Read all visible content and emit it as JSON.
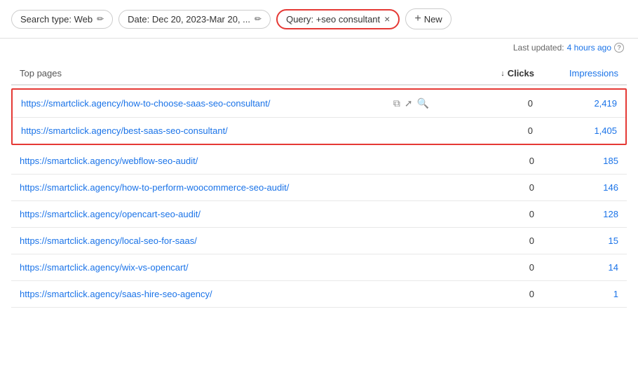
{
  "filterBar": {
    "searchType": {
      "label": "Search type: Web",
      "editIcon": "✏"
    },
    "date": {
      "label": "Date: Dec 20, 2023-Mar 20, ...",
      "editIcon": "✏"
    },
    "query": {
      "label": "Query: +seo consultant",
      "closeIcon": "×"
    },
    "newButton": {
      "label": "New",
      "plusIcon": "+"
    }
  },
  "lastUpdated": {
    "prefix": "Last updated:",
    "timeAgo": "4 hours ago",
    "infoIcon": "?"
  },
  "table": {
    "columns": {
      "page": "Top pages",
      "clicks": "Clicks",
      "impressions": "Impressions",
      "sortIcon": "↓"
    },
    "rows": [
      {
        "url": "https://smartclick.agency/how-to-choose-saas-seo-consultant/",
        "clicks": "0",
        "impressions": "2,419",
        "highlighted": true,
        "showIcons": true
      },
      {
        "url": "https://smartclick.agency/best-saas-seo-consultant/",
        "clicks": "0",
        "impressions": "1,405",
        "highlighted": true,
        "showIcons": false
      },
      {
        "url": "https://smartclick.agency/webflow-seo-audit/",
        "clicks": "0",
        "impressions": "185",
        "highlighted": false,
        "showIcons": false
      },
      {
        "url": "https://smartclick.agency/how-to-perform-woocommerce-seo-audit/",
        "clicks": "0",
        "impressions": "146",
        "highlighted": false,
        "showIcons": false
      },
      {
        "url": "https://smartclick.agency/opencart-seo-audit/",
        "clicks": "0",
        "impressions": "128",
        "highlighted": false,
        "showIcons": false
      },
      {
        "url": "https://smartclick.agency/local-seo-for-saas/",
        "clicks": "0",
        "impressions": "15",
        "highlighted": false,
        "showIcons": false
      },
      {
        "url": "https://smartclick.agency/wix-vs-opencart/",
        "clicks": "0",
        "impressions": "14",
        "highlighted": false,
        "showIcons": false
      },
      {
        "url": "https://smartclick.agency/saas-hire-seo-agency/",
        "clicks": "0",
        "impressions": "1",
        "highlighted": false,
        "showIcons": false
      }
    ]
  }
}
